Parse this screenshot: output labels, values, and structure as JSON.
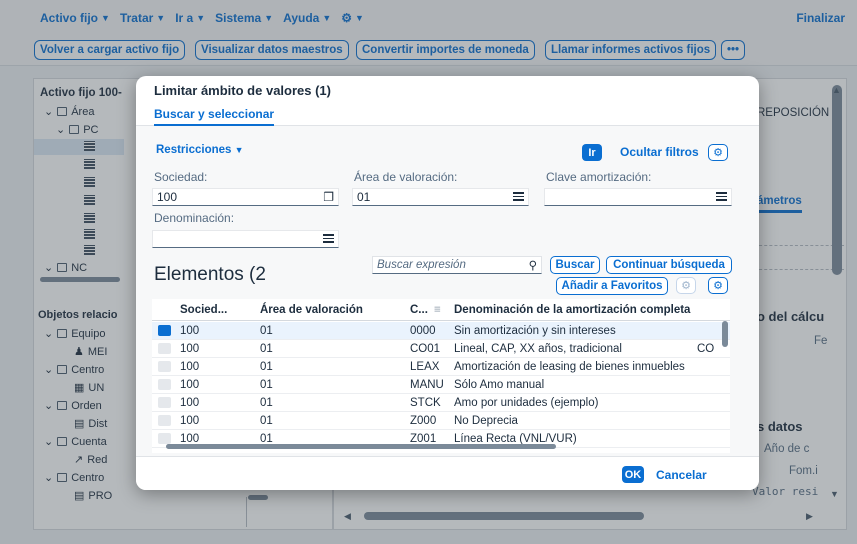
{
  "menu": {
    "items": [
      "Activo fijo",
      "Tratar",
      "Ir a",
      "Sistema",
      "Ayuda"
    ],
    "finalizar": "Finalizar"
  },
  "toolbar": {
    "buttons": [
      "Volver a cargar activo fijo",
      "Visualizar datos maestros",
      "Convertir importes de moneda",
      "Llamar informes activos fijos"
    ],
    "more": "•••"
  },
  "background": {
    "tree_header": "Activo fijo 100-",
    "tree_nodes": [
      "Área",
      "PC",
      "NC"
    ],
    "objects_header": "Objetos relacio",
    "objects": [
      "Equipo",
      "MEI",
      "Centro",
      "UN",
      "Orden",
      "Dist",
      "Cuenta",
      "Red",
      "Centro",
      "PRO"
    ],
    "right_texts": {
      "reposicion": "REPOSICIÓN",
      "parametros": "ámetros",
      "calculo": "o del cálcu",
      "fe": "Fe",
      "datos": "s datos",
      "ano": "Año de c",
      "fom": "Fom.i",
      "valor": "Valor resi"
    }
  },
  "dialog": {
    "title": "Limitar ámbito de valores (1)",
    "tab": "Buscar y seleccionar",
    "restricciones": "Restricciones",
    "ir": "Ir",
    "ocultar_filtros": "Ocultar filtros",
    "fields": {
      "sociedad_label": "Sociedad:",
      "sociedad_value": "100",
      "area_label": "Área de valoración:",
      "area_value": "01",
      "clave_label": "Clave amortización:",
      "clave_value": "",
      "denominacion_label": "Denominación:",
      "denominacion_value": ""
    },
    "elementos_title": "Elementos (2",
    "search_placeholder": "Buscar expresión",
    "buscar": "Buscar",
    "continuar": "Continuar búsqueda",
    "favoritos": "Añadir a Favoritos",
    "table": {
      "headers": [
        "Socied...",
        "Área de valoración",
        "C...",
        "Denominación de la amortización completa"
      ],
      "rows": [
        {
          "sociedad": "100",
          "area": "01",
          "clave": "0000",
          "denominacion": "Sin amortización y sin intereses",
          "selected": true
        },
        {
          "sociedad": "100",
          "area": "01",
          "clave": "CO01",
          "denominacion": "Lineal, CAP, XX años, tradicional",
          "extra": "CO",
          "selected": false
        },
        {
          "sociedad": "100",
          "area": "01",
          "clave": "LEAX",
          "denominacion": "Amortización de leasing de bienes inmuebles",
          "selected": false
        },
        {
          "sociedad": "100",
          "area": "01",
          "clave": "MANU",
          "denominacion": "Sólo Amo manual",
          "selected": false
        },
        {
          "sociedad": "100",
          "area": "01",
          "clave": "STCK",
          "denominacion": "Amo por unidades (ejemplo)",
          "selected": false
        },
        {
          "sociedad": "100",
          "area": "01",
          "clave": "Z000",
          "denominacion": "No Deprecia",
          "selected": false
        },
        {
          "sociedad": "100",
          "area": "01",
          "clave": "Z001",
          "denominacion": "Línea Recta (VNL/VUR)",
          "selected": false
        }
      ]
    },
    "ok": "OK",
    "cancelar": "Cancelar"
  },
  "colors": {
    "accent": "#0a6ed1"
  }
}
